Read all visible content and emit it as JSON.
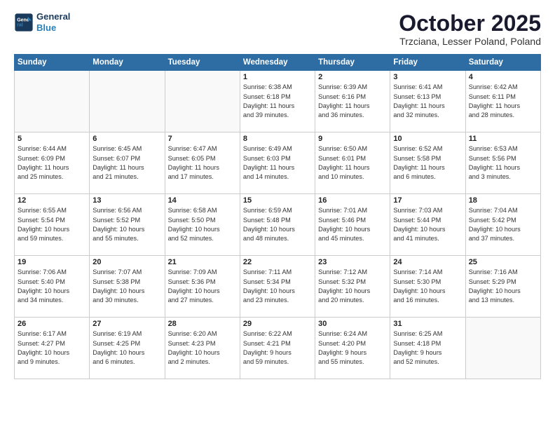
{
  "header": {
    "logo_line1": "General",
    "logo_line2": "Blue",
    "month": "October 2025",
    "location": "Trzciana, Lesser Poland, Poland"
  },
  "days_of_week": [
    "Sunday",
    "Monday",
    "Tuesday",
    "Wednesday",
    "Thursday",
    "Friday",
    "Saturday"
  ],
  "weeks": [
    [
      {
        "day": "",
        "info": ""
      },
      {
        "day": "",
        "info": ""
      },
      {
        "day": "",
        "info": ""
      },
      {
        "day": "1",
        "info": "Sunrise: 6:38 AM\nSunset: 6:18 PM\nDaylight: 11 hours\nand 39 minutes."
      },
      {
        "day": "2",
        "info": "Sunrise: 6:39 AM\nSunset: 6:16 PM\nDaylight: 11 hours\nand 36 minutes."
      },
      {
        "day": "3",
        "info": "Sunrise: 6:41 AM\nSunset: 6:13 PM\nDaylight: 11 hours\nand 32 minutes."
      },
      {
        "day": "4",
        "info": "Sunrise: 6:42 AM\nSunset: 6:11 PM\nDaylight: 11 hours\nand 28 minutes."
      }
    ],
    [
      {
        "day": "5",
        "info": "Sunrise: 6:44 AM\nSunset: 6:09 PM\nDaylight: 11 hours\nand 25 minutes."
      },
      {
        "day": "6",
        "info": "Sunrise: 6:45 AM\nSunset: 6:07 PM\nDaylight: 11 hours\nand 21 minutes."
      },
      {
        "day": "7",
        "info": "Sunrise: 6:47 AM\nSunset: 6:05 PM\nDaylight: 11 hours\nand 17 minutes."
      },
      {
        "day": "8",
        "info": "Sunrise: 6:49 AM\nSunset: 6:03 PM\nDaylight: 11 hours\nand 14 minutes."
      },
      {
        "day": "9",
        "info": "Sunrise: 6:50 AM\nSunset: 6:01 PM\nDaylight: 11 hours\nand 10 minutes."
      },
      {
        "day": "10",
        "info": "Sunrise: 6:52 AM\nSunset: 5:58 PM\nDaylight: 11 hours\nand 6 minutes."
      },
      {
        "day": "11",
        "info": "Sunrise: 6:53 AM\nSunset: 5:56 PM\nDaylight: 11 hours\nand 3 minutes."
      }
    ],
    [
      {
        "day": "12",
        "info": "Sunrise: 6:55 AM\nSunset: 5:54 PM\nDaylight: 10 hours\nand 59 minutes."
      },
      {
        "day": "13",
        "info": "Sunrise: 6:56 AM\nSunset: 5:52 PM\nDaylight: 10 hours\nand 55 minutes."
      },
      {
        "day": "14",
        "info": "Sunrise: 6:58 AM\nSunset: 5:50 PM\nDaylight: 10 hours\nand 52 minutes."
      },
      {
        "day": "15",
        "info": "Sunrise: 6:59 AM\nSunset: 5:48 PM\nDaylight: 10 hours\nand 48 minutes."
      },
      {
        "day": "16",
        "info": "Sunrise: 7:01 AM\nSunset: 5:46 PM\nDaylight: 10 hours\nand 45 minutes."
      },
      {
        "day": "17",
        "info": "Sunrise: 7:03 AM\nSunset: 5:44 PM\nDaylight: 10 hours\nand 41 minutes."
      },
      {
        "day": "18",
        "info": "Sunrise: 7:04 AM\nSunset: 5:42 PM\nDaylight: 10 hours\nand 37 minutes."
      }
    ],
    [
      {
        "day": "19",
        "info": "Sunrise: 7:06 AM\nSunset: 5:40 PM\nDaylight: 10 hours\nand 34 minutes."
      },
      {
        "day": "20",
        "info": "Sunrise: 7:07 AM\nSunset: 5:38 PM\nDaylight: 10 hours\nand 30 minutes."
      },
      {
        "day": "21",
        "info": "Sunrise: 7:09 AM\nSunset: 5:36 PM\nDaylight: 10 hours\nand 27 minutes."
      },
      {
        "day": "22",
        "info": "Sunrise: 7:11 AM\nSunset: 5:34 PM\nDaylight: 10 hours\nand 23 minutes."
      },
      {
        "day": "23",
        "info": "Sunrise: 7:12 AM\nSunset: 5:32 PM\nDaylight: 10 hours\nand 20 minutes."
      },
      {
        "day": "24",
        "info": "Sunrise: 7:14 AM\nSunset: 5:30 PM\nDaylight: 10 hours\nand 16 minutes."
      },
      {
        "day": "25",
        "info": "Sunrise: 7:16 AM\nSunset: 5:29 PM\nDaylight: 10 hours\nand 13 minutes."
      }
    ],
    [
      {
        "day": "26",
        "info": "Sunrise: 6:17 AM\nSunset: 4:27 PM\nDaylight: 10 hours\nand 9 minutes."
      },
      {
        "day": "27",
        "info": "Sunrise: 6:19 AM\nSunset: 4:25 PM\nDaylight: 10 hours\nand 6 minutes."
      },
      {
        "day": "28",
        "info": "Sunrise: 6:20 AM\nSunset: 4:23 PM\nDaylight: 10 hours\nand 2 minutes."
      },
      {
        "day": "29",
        "info": "Sunrise: 6:22 AM\nSunset: 4:21 PM\nDaylight: 9 hours\nand 59 minutes."
      },
      {
        "day": "30",
        "info": "Sunrise: 6:24 AM\nSunset: 4:20 PM\nDaylight: 9 hours\nand 55 minutes."
      },
      {
        "day": "31",
        "info": "Sunrise: 6:25 AM\nSunset: 4:18 PM\nDaylight: 9 hours\nand 52 minutes."
      },
      {
        "day": "",
        "info": ""
      }
    ]
  ]
}
